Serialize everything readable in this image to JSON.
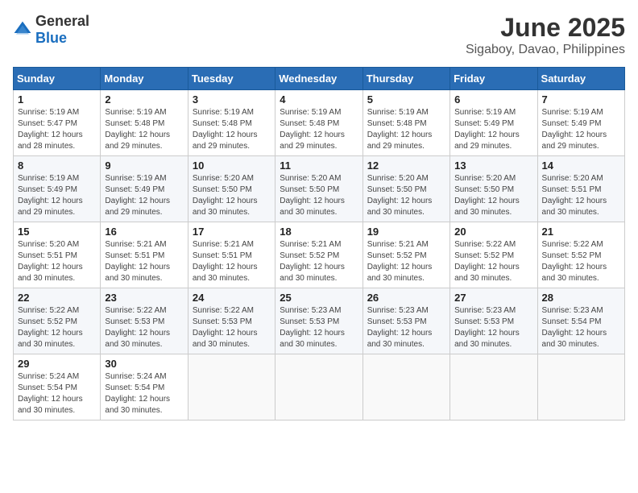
{
  "logo": {
    "text_general": "General",
    "text_blue": "Blue"
  },
  "title": "June 2025",
  "location": "Sigaboy, Davao, Philippines",
  "days_of_week": [
    "Sunday",
    "Monday",
    "Tuesday",
    "Wednesday",
    "Thursday",
    "Friday",
    "Saturday"
  ],
  "weeks": [
    [
      {
        "day": "1",
        "sunrise": "5:19 AM",
        "sunset": "5:47 PM",
        "daylight": "12 hours and 28 minutes."
      },
      {
        "day": "2",
        "sunrise": "5:19 AM",
        "sunset": "5:48 PM",
        "daylight": "12 hours and 29 minutes."
      },
      {
        "day": "3",
        "sunrise": "5:19 AM",
        "sunset": "5:48 PM",
        "daylight": "12 hours and 29 minutes."
      },
      {
        "day": "4",
        "sunrise": "5:19 AM",
        "sunset": "5:48 PM",
        "daylight": "12 hours and 29 minutes."
      },
      {
        "day": "5",
        "sunrise": "5:19 AM",
        "sunset": "5:48 PM",
        "daylight": "12 hours and 29 minutes."
      },
      {
        "day": "6",
        "sunrise": "5:19 AM",
        "sunset": "5:49 PM",
        "daylight": "12 hours and 29 minutes."
      },
      {
        "day": "7",
        "sunrise": "5:19 AM",
        "sunset": "5:49 PM",
        "daylight": "12 hours and 29 minutes."
      }
    ],
    [
      {
        "day": "8",
        "sunrise": "5:19 AM",
        "sunset": "5:49 PM",
        "daylight": "12 hours and 29 minutes."
      },
      {
        "day": "9",
        "sunrise": "5:19 AM",
        "sunset": "5:49 PM",
        "daylight": "12 hours and 29 minutes."
      },
      {
        "day": "10",
        "sunrise": "5:20 AM",
        "sunset": "5:50 PM",
        "daylight": "12 hours and 30 minutes."
      },
      {
        "day": "11",
        "sunrise": "5:20 AM",
        "sunset": "5:50 PM",
        "daylight": "12 hours and 30 minutes."
      },
      {
        "day": "12",
        "sunrise": "5:20 AM",
        "sunset": "5:50 PM",
        "daylight": "12 hours and 30 minutes."
      },
      {
        "day": "13",
        "sunrise": "5:20 AM",
        "sunset": "5:50 PM",
        "daylight": "12 hours and 30 minutes."
      },
      {
        "day": "14",
        "sunrise": "5:20 AM",
        "sunset": "5:51 PM",
        "daylight": "12 hours and 30 minutes."
      }
    ],
    [
      {
        "day": "15",
        "sunrise": "5:20 AM",
        "sunset": "5:51 PM",
        "daylight": "12 hours and 30 minutes."
      },
      {
        "day": "16",
        "sunrise": "5:21 AM",
        "sunset": "5:51 PM",
        "daylight": "12 hours and 30 minutes."
      },
      {
        "day": "17",
        "sunrise": "5:21 AM",
        "sunset": "5:51 PM",
        "daylight": "12 hours and 30 minutes."
      },
      {
        "day": "18",
        "sunrise": "5:21 AM",
        "sunset": "5:52 PM",
        "daylight": "12 hours and 30 minutes."
      },
      {
        "day": "19",
        "sunrise": "5:21 AM",
        "sunset": "5:52 PM",
        "daylight": "12 hours and 30 minutes."
      },
      {
        "day": "20",
        "sunrise": "5:22 AM",
        "sunset": "5:52 PM",
        "daylight": "12 hours and 30 minutes."
      },
      {
        "day": "21",
        "sunrise": "5:22 AM",
        "sunset": "5:52 PM",
        "daylight": "12 hours and 30 minutes."
      }
    ],
    [
      {
        "day": "22",
        "sunrise": "5:22 AM",
        "sunset": "5:52 PM",
        "daylight": "12 hours and 30 minutes."
      },
      {
        "day": "23",
        "sunrise": "5:22 AM",
        "sunset": "5:53 PM",
        "daylight": "12 hours and 30 minutes."
      },
      {
        "day": "24",
        "sunrise": "5:22 AM",
        "sunset": "5:53 PM",
        "daylight": "12 hours and 30 minutes."
      },
      {
        "day": "25",
        "sunrise": "5:23 AM",
        "sunset": "5:53 PM",
        "daylight": "12 hours and 30 minutes."
      },
      {
        "day": "26",
        "sunrise": "5:23 AM",
        "sunset": "5:53 PM",
        "daylight": "12 hours and 30 minutes."
      },
      {
        "day": "27",
        "sunrise": "5:23 AM",
        "sunset": "5:53 PM",
        "daylight": "12 hours and 30 minutes."
      },
      {
        "day": "28",
        "sunrise": "5:23 AM",
        "sunset": "5:54 PM",
        "daylight": "12 hours and 30 minutes."
      }
    ],
    [
      {
        "day": "29",
        "sunrise": "5:24 AM",
        "sunset": "5:54 PM",
        "daylight": "12 hours and 30 minutes."
      },
      {
        "day": "30",
        "sunrise": "5:24 AM",
        "sunset": "5:54 PM",
        "daylight": "12 hours and 30 minutes."
      },
      null,
      null,
      null,
      null,
      null
    ]
  ]
}
